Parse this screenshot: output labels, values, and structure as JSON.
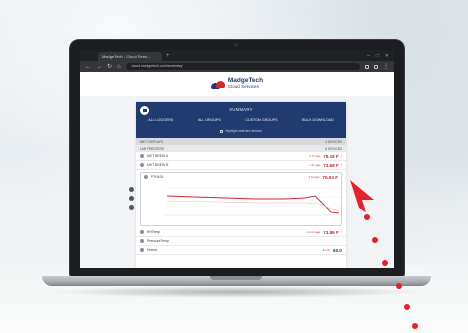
{
  "browser": {
    "tab_title": "MadgeTech - Cloud Servi...",
    "url": "cloud.madgetech.com/summary"
  },
  "brand": {
    "name": "MadgeTech",
    "subtitle": "Cloud Services"
  },
  "header": {
    "title": "SUMMARY",
    "nav": [
      "ALL LOGGERS",
      "ALL GROUPS",
      "CUSTOM GROUPS",
      "BULK DOWNLOAD"
    ],
    "checkbox_label": "Highlight selected devices"
  },
  "groups": [
    {
      "name": "MKT DISPLAYS",
      "count": "4 DEVICES"
    },
    {
      "name": "LAB FREEZERS",
      "count": "6 DEVICES"
    }
  ],
  "rows": [
    {
      "name": "MKT BREW A",
      "small": "1 hr ago",
      "value": "75.18 F"
    },
    {
      "name": "MKT BREW B",
      "small": "1 hr ago",
      "value": "73.68 F"
    }
  ],
  "chart_row": {
    "name": "PTH100",
    "small": "1 hr ago",
    "value": "75.04 F"
  },
  "after_rows": [
    {
      "name": "RHTemp",
      "small": "1 min ago",
      "value": "73.86 F"
    },
    {
      "name": "PressureTemp",
      "small": "",
      "value": ""
    },
    {
      "name": "Humid",
      "small": "6 min",
      "value": "60.0"
    }
  ],
  "colors": {
    "brand_navy": "#1f3b6f",
    "accent_red": "#d6262f",
    "dots": "#e3222b"
  }
}
